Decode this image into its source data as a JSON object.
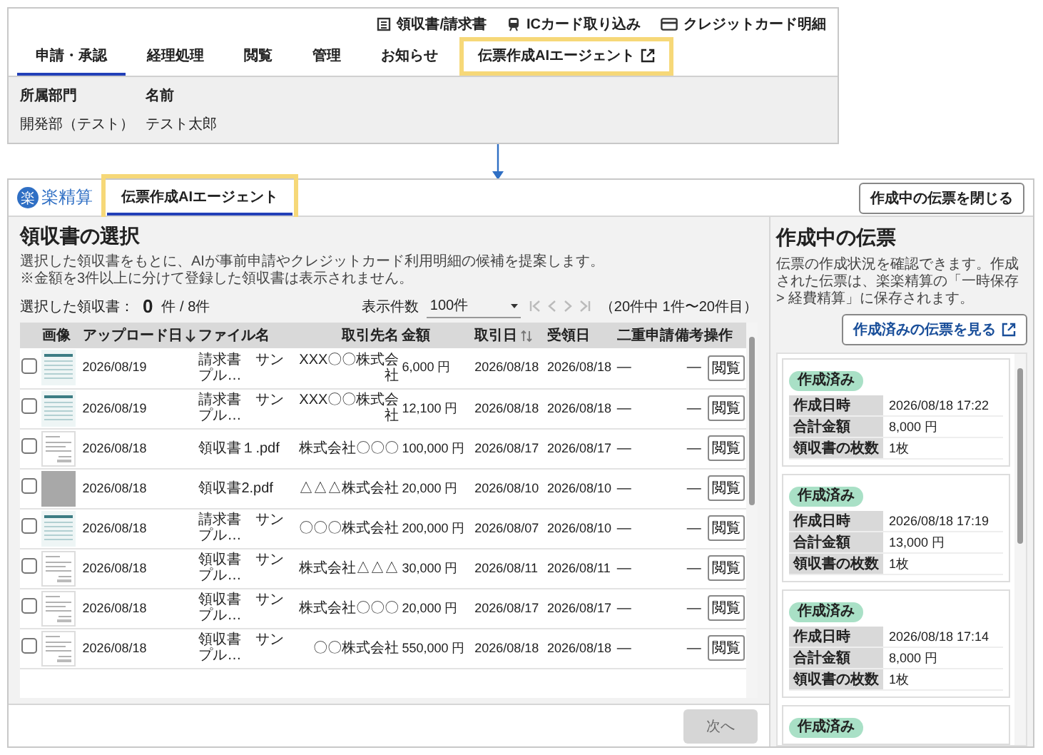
{
  "top_screen": {
    "header_links": [
      {
        "label": "領収書/請求書",
        "kind": "document"
      },
      {
        "label": "ICカード取り込み",
        "kind": "train"
      },
      {
        "label": "クレジットカード明細",
        "kind": "card"
      }
    ],
    "tabs": [
      {
        "label": "申請・承認",
        "selected": true,
        "highlighted": false,
        "external": false
      },
      {
        "label": "経理処理",
        "selected": false,
        "highlighted": false,
        "external": false
      },
      {
        "label": "閲覧",
        "selected": false,
        "highlighted": false,
        "external": false
      },
      {
        "label": "管理",
        "selected": false,
        "highlighted": false,
        "external": false
      },
      {
        "label": "お知らせ",
        "selected": false,
        "highlighted": false,
        "external": false
      },
      {
        "label": "伝票作成AIエージェント",
        "selected": false,
        "highlighted": true,
        "external": true
      }
    ],
    "user_info": {
      "labels": [
        "所属部門",
        "名前"
      ],
      "values": [
        "開発部（テスト）",
        "テスト太郎"
      ]
    }
  },
  "app": {
    "logo_mark": "楽",
    "logo_text": "楽精算",
    "tabs": [
      {
        "label": "伝票作成AIエージェント",
        "selected": true,
        "highlighted": true
      }
    ],
    "close_button": "作成中の伝票を閉じる"
  },
  "receipts": {
    "title": "領収書の選択",
    "description": [
      "選択した領収書をもとに、AIが事前申請やクレジットカード利用明細の候補を提案します。",
      "※金額を3件以上に分けて登録した領収書は表示されません。"
    ],
    "selected_label": "選択した領収書：",
    "selected_count": "0",
    "selected_total": "件 / 8件",
    "page_size_label": "表示件数",
    "page_size": "100件",
    "range": "（20件中 1件〜20件目）",
    "columns": [
      {
        "label": "画像"
      },
      {
        "label": "アップロード日",
        "sorted_descending": true
      },
      {
        "label": "ファイル名"
      },
      {
        "label": "取引先名"
      },
      {
        "label": "金額"
      },
      {
        "label": "取引日",
        "sortable": true
      },
      {
        "label": "受領日"
      },
      {
        "label": "二重申請"
      },
      {
        "label": "備考"
      },
      {
        "label": "操作"
      }
    ],
    "rows": [
      {
        "checked": false,
        "kind": "invoice",
        "upload_date": "2026/08/19",
        "file": "請求書　サンプル…",
        "vendor": "XXX〇〇株式会社",
        "amount": "6,000 円",
        "trade_date": "2026/08/18",
        "received": "2026/08/18",
        "duplicate": "—",
        "note": "—",
        "action": "閲覧"
      },
      {
        "checked": false,
        "kind": "invoice",
        "upload_date": "2026/08/19",
        "file": "請求書　サンプル…",
        "vendor": "XXX〇〇株式会社",
        "amount": "12,100 円",
        "trade_date": "2026/08/18",
        "received": "2026/08/18",
        "duplicate": "—",
        "note": "—",
        "action": "閲覧"
      },
      {
        "checked": false,
        "kind": "receipt",
        "upload_date": "2026/08/18",
        "file": "領収書１.pdf",
        "vendor": "株式会社〇〇〇",
        "amount": "100,000 円",
        "trade_date": "2026/08/17",
        "received": "2026/08/17",
        "duplicate": "—",
        "note": "—",
        "action": "閲覧"
      },
      {
        "checked": false,
        "kind": "photo",
        "upload_date": "2026/08/18",
        "file": "領収書2.pdf",
        "vendor": "△△△株式会社",
        "amount": "20,000 円",
        "trade_date": "2026/08/10",
        "received": "2026/08/10",
        "duplicate": "—",
        "note": "—",
        "action": "閲覧"
      },
      {
        "checked": false,
        "kind": "invoice",
        "upload_date": "2026/08/18",
        "file": "請求書　サンプル…",
        "vendor": "〇〇〇株式会社",
        "amount": "200,000 円",
        "trade_date": "2026/08/07",
        "received": "2026/08/10",
        "duplicate": "—",
        "note": "—",
        "action": "閲覧"
      },
      {
        "checked": false,
        "kind": "receipt",
        "upload_date": "2026/08/18",
        "file": "領収書　サンプル…",
        "vendor": "株式会社△△△",
        "amount": "30,000 円",
        "trade_date": "2026/08/11",
        "received": "2026/08/11",
        "duplicate": "—",
        "note": "—",
        "action": "閲覧"
      },
      {
        "checked": false,
        "kind": "receipt",
        "upload_date": "2026/08/18",
        "file": "領収書　サンプル…",
        "vendor": "株式会社〇〇〇",
        "amount": "20,000 円",
        "trade_date": "2026/08/17",
        "received": "2026/08/17",
        "duplicate": "—",
        "note": "—",
        "action": "閲覧"
      },
      {
        "checked": false,
        "kind": "receipt",
        "upload_date": "2026/08/18",
        "file": "領収書　サンプル…",
        "vendor": "〇〇株式会社",
        "amount": "550,000 円",
        "trade_date": "2026/08/18",
        "received": "2026/08/18",
        "duplicate": "—",
        "note": "—",
        "action": "閲覧"
      }
    ],
    "next_button": {
      "label": "次へ",
      "disabled": true
    }
  },
  "vouchers": {
    "title": "作成中の伝票",
    "description": "伝票の作成状況を確認できます。作成された伝票は、楽楽精算の「一時保存 > 経費精算」に保存されます。",
    "view_button": "作成済みの伝票を見る",
    "items": [
      {
        "status": "作成済み",
        "rows": [
          {
            "label": "作成日時",
            "value": "2026/08/18 17:22"
          },
          {
            "label": "合計金額",
            "value": "8,000 円"
          },
          {
            "label": "領収書の枚数",
            "value": "1枚"
          }
        ]
      },
      {
        "status": "作成済み",
        "rows": [
          {
            "label": "作成日時",
            "value": "2026/08/18 17:19"
          },
          {
            "label": "合計金額",
            "value": "13,000 円"
          },
          {
            "label": "領収書の枚数",
            "value": "1枚"
          }
        ]
      },
      {
        "status": "作成済み",
        "rows": [
          {
            "label": "作成日時",
            "value": "2026/08/18 17:14"
          },
          {
            "label": "合計金額",
            "value": "8,000 円"
          },
          {
            "label": "領収書の枚数",
            "value": "1枚"
          }
        ]
      },
      {
        "status": "作成済み"
      }
    ]
  }
}
